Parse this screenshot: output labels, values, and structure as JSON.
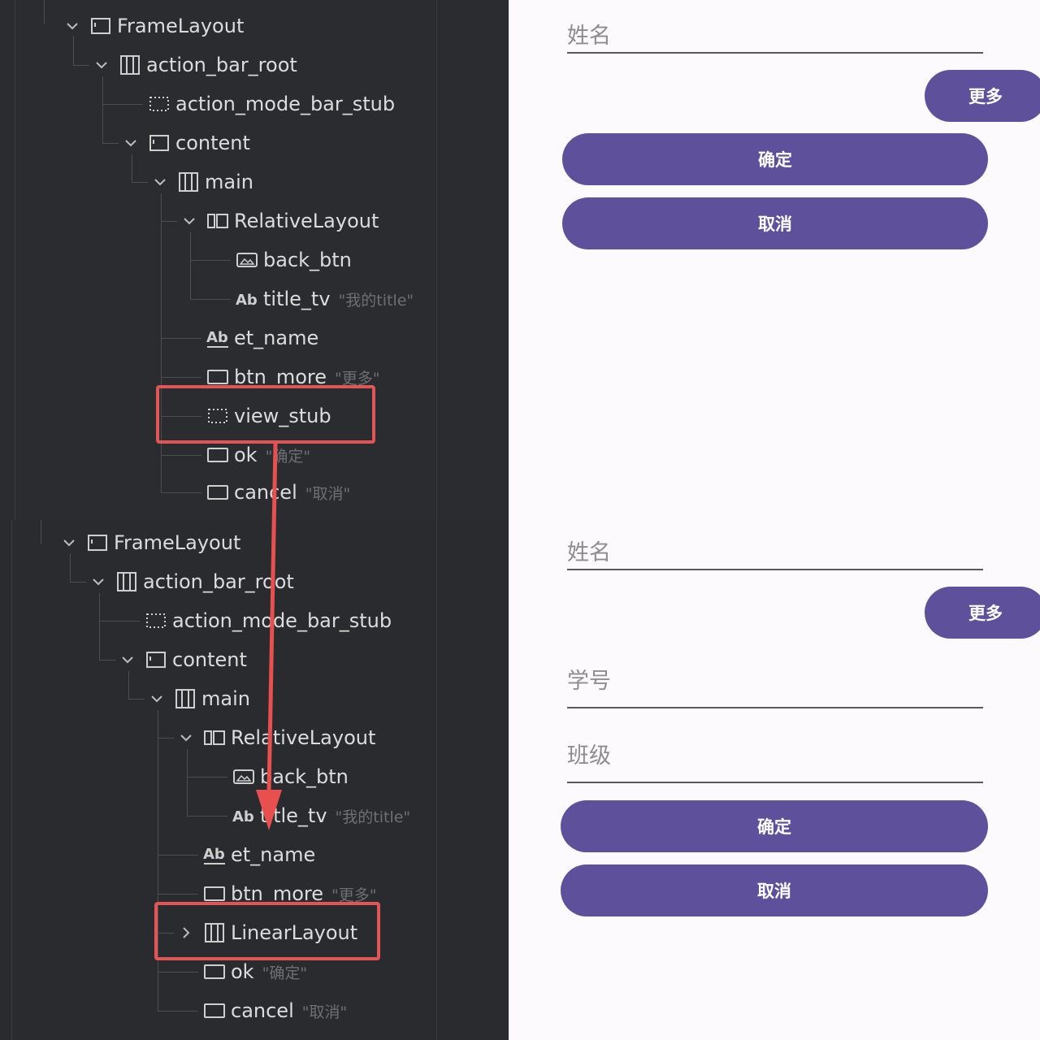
{
  "top_tree": {
    "rows": [
      {
        "label": "FrameLayout",
        "icon": "frame-icon",
        "hint": ""
      },
      {
        "label": "action_bar_root",
        "icon": "linear-icon",
        "hint": ""
      },
      {
        "label": "action_mode_bar_stub",
        "icon": "stub-icon",
        "hint": ""
      },
      {
        "label": "content",
        "icon": "frame-icon",
        "hint": ""
      },
      {
        "label": "main",
        "icon": "linear-icon",
        "hint": ""
      },
      {
        "label": "RelativeLayout",
        "icon": "relative-icon",
        "hint": ""
      },
      {
        "label": "back_btn",
        "icon": "image-icon",
        "hint": ""
      },
      {
        "label": "title_tv",
        "icon": "text-icon",
        "hint": "\"我的title\""
      },
      {
        "label": "et_name",
        "icon": "edittext-icon",
        "hint": ""
      },
      {
        "label": "btn_more",
        "icon": "button-icon",
        "hint": "\"更多\""
      },
      {
        "label": "view_stub",
        "icon": "stub-icon",
        "hint": ""
      },
      {
        "label": "ok",
        "icon": "button-icon",
        "hint": "\"确定\""
      },
      {
        "label": "cancel",
        "icon": "button-icon",
        "hint": "\"取消\""
      }
    ]
  },
  "bottom_tree": {
    "rows": [
      {
        "label": "FrameLayout",
        "icon": "frame-icon",
        "hint": ""
      },
      {
        "label": "action_bar_root",
        "icon": "linear-icon",
        "hint": ""
      },
      {
        "label": "action_mode_bar_stub",
        "icon": "stub-icon",
        "hint": ""
      },
      {
        "label": "content",
        "icon": "frame-icon",
        "hint": ""
      },
      {
        "label": "main",
        "icon": "linear-icon",
        "hint": ""
      },
      {
        "label": "RelativeLayout",
        "icon": "relative-icon",
        "hint": ""
      },
      {
        "label": "back_btn",
        "icon": "image-icon",
        "hint": ""
      },
      {
        "label": "title_tv",
        "icon": "text-icon",
        "hint": "\"我的title\""
      },
      {
        "label": "et_name",
        "icon": "edittext-icon",
        "hint": ""
      },
      {
        "label": "btn_more",
        "icon": "button-icon",
        "hint": "\"更多\""
      },
      {
        "label": "LinearLayout",
        "icon": "linear-icon",
        "hint": ""
      },
      {
        "label": "ok",
        "icon": "button-icon",
        "hint": "\"确定\""
      },
      {
        "label": "cancel",
        "icon": "button-icon",
        "hint": "\"取消\""
      }
    ]
  },
  "top_phone": {
    "name_placeholder": "姓名",
    "more_label": "更多",
    "ok_label": "确定",
    "cancel_label": "取消"
  },
  "bottom_phone": {
    "name_placeholder": "姓名",
    "more_label": "更多",
    "student_id_placeholder": "学号",
    "class_placeholder": "班级",
    "ok_label": "确定",
    "cancel_label": "取消"
  },
  "colors": {
    "accent": "#5f509c",
    "highlight": "#e05555",
    "tree_bg": "#2b2c30",
    "phone_bg": "#fcfafc"
  }
}
